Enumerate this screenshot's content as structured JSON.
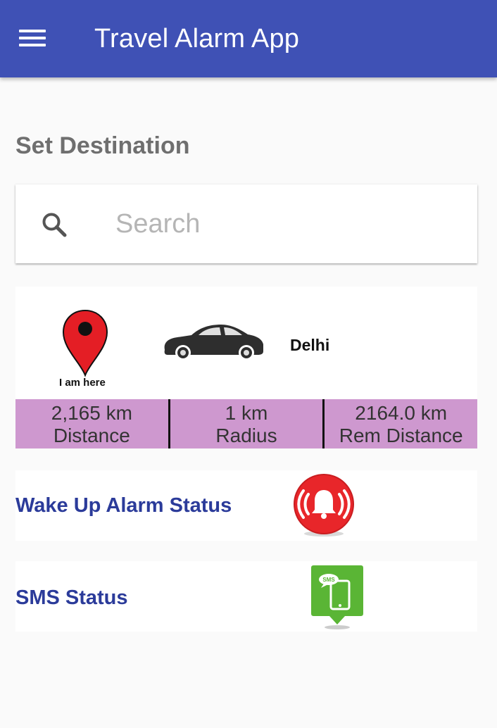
{
  "app_bar": {
    "title": "Travel Alarm App",
    "menu_icon": "hamburger-menu-icon",
    "background": "#3f51b5"
  },
  "destination": {
    "section_title": "Set Destination",
    "search": {
      "placeholder": "Search",
      "value": "",
      "icon": "search-icon"
    }
  },
  "trip": {
    "origin_label": "I am here",
    "origin_icon": "location-pin-icon",
    "vehicle_icon": "car-icon",
    "destination_name": "Delhi",
    "stats": [
      {
        "value": "2,165 km",
        "label": "Distance"
      },
      {
        "value": "1 km",
        "label": "Radius"
      },
      {
        "value": "2164.0 km",
        "label": "Rem Distance"
      }
    ],
    "stats_background": "#ce98cf"
  },
  "status": {
    "alarm": {
      "label": "Wake Up Alarm Status",
      "icon": "alarm-bell-icon",
      "color": "#e8262a"
    },
    "sms": {
      "label": "SMS Status",
      "icon": "sms-phone-icon",
      "color": "#5ab535"
    },
    "label_color": "#2b3b9a"
  }
}
